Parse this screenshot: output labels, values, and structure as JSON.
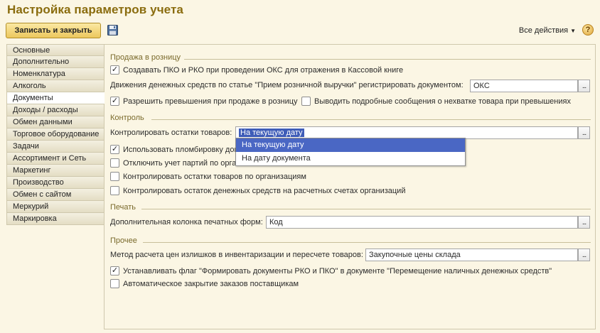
{
  "window": {
    "title": "Настройка параметров учета"
  },
  "toolbar": {
    "save_close_label": "Записать и закрыть",
    "all_actions_label": "Все действия",
    "help_label": "?"
  },
  "sidebar": {
    "items": [
      {
        "label": "Основные"
      },
      {
        "label": "Дополнительно"
      },
      {
        "label": "Номенклатура"
      },
      {
        "label": "Алкоголь"
      },
      {
        "label": "Документы"
      },
      {
        "label": "Доходы / расходы"
      },
      {
        "label": "Обмен данными"
      },
      {
        "label": "Торговое оборудование"
      },
      {
        "label": "Задачи"
      },
      {
        "label": "Ассортимент и Сеть"
      },
      {
        "label": "Маркетинг"
      },
      {
        "label": "Производство"
      },
      {
        "label": "Обмен с сайтом"
      },
      {
        "label": "Меркурий"
      },
      {
        "label": "Маркировка"
      }
    ],
    "active_index": 4
  },
  "retail": {
    "title": "Продажа в розницу",
    "create_pko": {
      "label": "Создавать ПКО и РКО при проведении ОКС для отражения в Кассовой книге",
      "checked": true
    },
    "movement_label": "Движения денежных средств по статье \"Прием розничной выручки\" регистрировать документом:",
    "movement_value": "ОКС",
    "allow_excess": {
      "label": "Разрешить превышения при продаже в розницу",
      "checked": true
    },
    "show_detailed": {
      "label": "Выводить подробные сообщения о нехватке товара при превышениях",
      "checked": false
    }
  },
  "control": {
    "title": "Контроль",
    "stock_label": "Контролировать остатки товаров:",
    "stock_value": "На текущую дату",
    "dropdown_options": [
      "На текущую дату",
      "На дату документа"
    ],
    "use_seals": {
      "label": "Использовать пломбировку док",
      "checked": true
    },
    "disable_batch": {
      "label": "Отключить учет партий по орган",
      "checked": false
    },
    "control_org_stock": {
      "label": "Контролировать остатки товаров по организациям",
      "checked": false
    },
    "control_cash": {
      "label": "Контролировать остаток денежных средств на расчетных счетах организаций",
      "checked": false
    }
  },
  "print": {
    "title": "Печать",
    "extra_col_label": "Дополнительная колонка печатных форм:",
    "extra_col_value": "Код"
  },
  "other": {
    "title": "Прочее",
    "price_method_label": "Метод расчета цен излишков в инвентаризации и пересчете товаров:",
    "price_method_value": "Закупочные цены склада",
    "set_flag": {
      "label": "Устанавливать флаг \"Формировать документы РКО и ПКО\" в документе \"Перемещение наличных денежных средств\"",
      "checked": true
    },
    "auto_close": {
      "label": "Автоматическое закрытие заказов поставщикам",
      "checked": false
    }
  },
  "icons": {
    "save": "floppy-disk-icon",
    "help": "help-icon",
    "select": "ellipsis-icon",
    "check": "checkmark-icon"
  },
  "colors": {
    "title": "#8a6c0e",
    "accent_button": "#ecc75d",
    "selection": "#3f5db8",
    "background": "#fbf6e4"
  }
}
